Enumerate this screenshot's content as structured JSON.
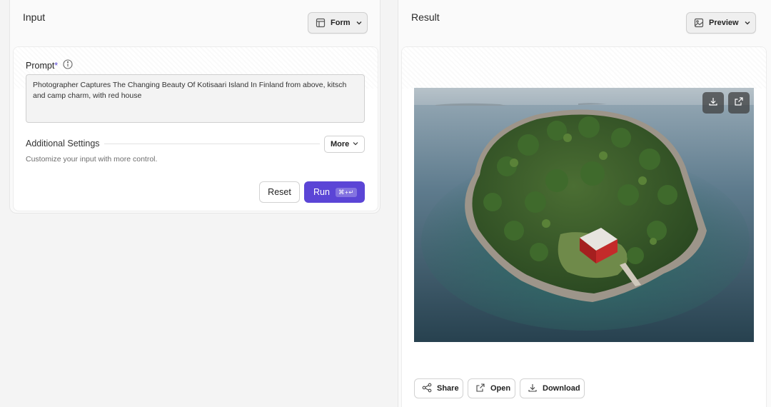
{
  "input_panel": {
    "title": "Input",
    "view_dropdown": {
      "label": "Form",
      "icon": "layout-icon"
    },
    "prompt": {
      "label": "Prompt",
      "required_mark": "*",
      "value": "Photographer Captures The Changing Beauty Of Kotisaari Island In Finland from above, kitsch and camp charm, with red house"
    },
    "settings": {
      "title": "Additional Settings",
      "description": "Customize your input with more control.",
      "more_label": "More"
    },
    "reset_label": "Reset",
    "run_label": "Run",
    "run_shortcut": "⌘+↵"
  },
  "result_panel": {
    "title": "Result",
    "view_dropdown": {
      "label": "Preview",
      "icon": "image-icon"
    },
    "actions": {
      "share_label": "Share",
      "open_label": "Open",
      "download_label": "Download"
    }
  },
  "colors": {
    "accent": "#5b45d6",
    "background": "#f4f4f4",
    "panel": "#fafafa"
  }
}
